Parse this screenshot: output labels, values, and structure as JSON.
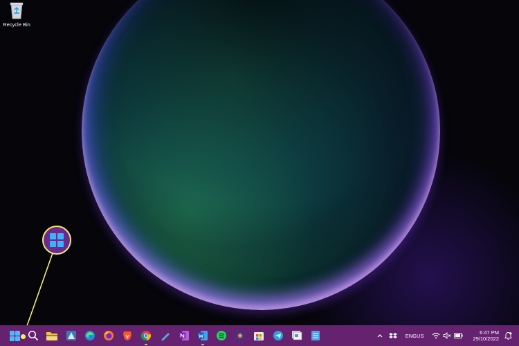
{
  "desktop": {
    "recycle_bin_label": "Recycle Bin"
  },
  "taskbar": {
    "apps": [
      {
        "name": "start",
        "icon": "windows-logo-icon"
      },
      {
        "name": "search",
        "icon": "search-icon"
      },
      {
        "name": "file-explorer",
        "icon": "folder-icon"
      },
      {
        "name": "app-4",
        "icon": "app-icon"
      },
      {
        "name": "edge",
        "icon": "edge-icon"
      },
      {
        "name": "firefox",
        "icon": "firefox-icon"
      },
      {
        "name": "brave",
        "icon": "brave-icon"
      },
      {
        "name": "chrome",
        "icon": "chrome-icon"
      },
      {
        "name": "pen-app",
        "icon": "pen-icon"
      },
      {
        "name": "onenote",
        "icon": "onenote-icon"
      },
      {
        "name": "word",
        "icon": "word-icon"
      },
      {
        "name": "spotify",
        "icon": "spotify-icon"
      },
      {
        "name": "app-13",
        "icon": "app-icon"
      },
      {
        "name": "store",
        "icon": "store-icon"
      },
      {
        "name": "telegram",
        "icon": "telegram-icon"
      },
      {
        "name": "app-16",
        "icon": "app-icon"
      },
      {
        "name": "notepad",
        "icon": "notepad-icon"
      }
    ],
    "tray": {
      "language_top": "ENG",
      "language_bottom": "US",
      "time": "6:47 PM",
      "date": "29/10/2022"
    }
  },
  "colors": {
    "taskbar": "#65236f",
    "callout_border": "#f2ee6a",
    "windows_blue": "#38b3ff"
  }
}
